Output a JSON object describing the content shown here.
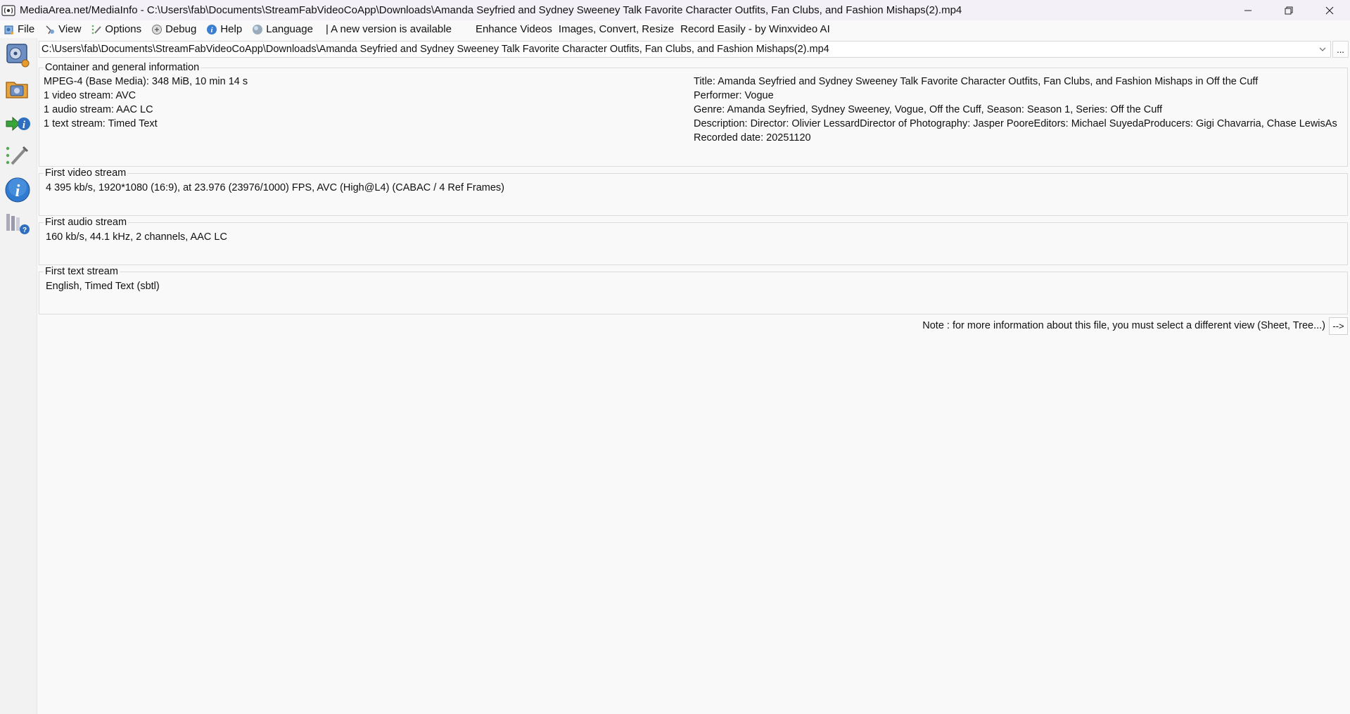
{
  "window": {
    "title": "MediaArea.net/MediaInfo - C:\\Users\\fab\\Documents\\StreamFabVideoCoApp\\Downloads\\Amanda Seyfried and Sydney Sweeney Talk Favorite Character Outfits, Fan Clubs, and Fashion Mishaps(2).mp4",
    "controls": [
      "minimize-icon",
      "restore-icon",
      "close-icon"
    ]
  },
  "menu": {
    "file": "File",
    "view": "View",
    "options": "Options",
    "debug": "Debug",
    "help": "Help",
    "language": "Language",
    "new_version": "| A new version is available",
    "promo1": "Enhance Videos",
    "promo2": "Images, Convert, Resize",
    "promo3": "Record Easily - by Winxvideo AI"
  },
  "sidebar": {
    "icons": [
      "open-file-icon",
      "open-folder-icon",
      "export-icon",
      "preferences-icon",
      "about-icon",
      "knowledge-base-icon"
    ]
  },
  "path": {
    "value": "C:\\Users\\fab\\Documents\\StreamFabVideoCoApp\\Downloads\\Amanda Seyfried and Sydney Sweeney Talk Favorite Character Outfits, Fan Clubs, and Fashion Mishaps(2).mp4",
    "browse": "..."
  },
  "general": {
    "heading": "Container and general information",
    "left": [
      "MPEG-4 (Base Media): 348 MiB, 10 min 14 s",
      "1 video stream: AVC",
      "1 audio stream: AAC LC",
      "1 text stream: Timed Text"
    ],
    "right": [
      "Title: Amanda Seyfried and Sydney Sweeney Talk Favorite Character Outfits, Fan Clubs, and Fashion Mishaps in Off the Cuff",
      "Performer: Vogue",
      "Genre: Amanda Seyfried, Sydney Sweeney, Vogue, Off the Cuff, Season: Season 1, Series: Off the Cuff",
      "Description: Director: Olivier LessardDirector of Photography: Jasper PooreEditors: Michael SuyedaProducers: Gigi Chavarria, Chase LewisAs",
      "Recorded date: 20251120"
    ]
  },
  "video": {
    "heading": "First video stream",
    "line": "4 395 kb/s, 1920*1080 (16:9), at 23.976 (23976/1000) FPS, AVC (High@L4) (CABAC / 4 Ref Frames)"
  },
  "audio": {
    "heading": "First audio stream",
    "line": "160 kb/s, 44.1 kHz, 2 channels, AAC LC"
  },
  "text": {
    "heading": "First text stream",
    "line": "English, Timed Text (sbtl)"
  },
  "footer": {
    "note": "Note : for more information about this file, you must select a different view (Sheet, Tree...)",
    "next_button": "-->"
  }
}
